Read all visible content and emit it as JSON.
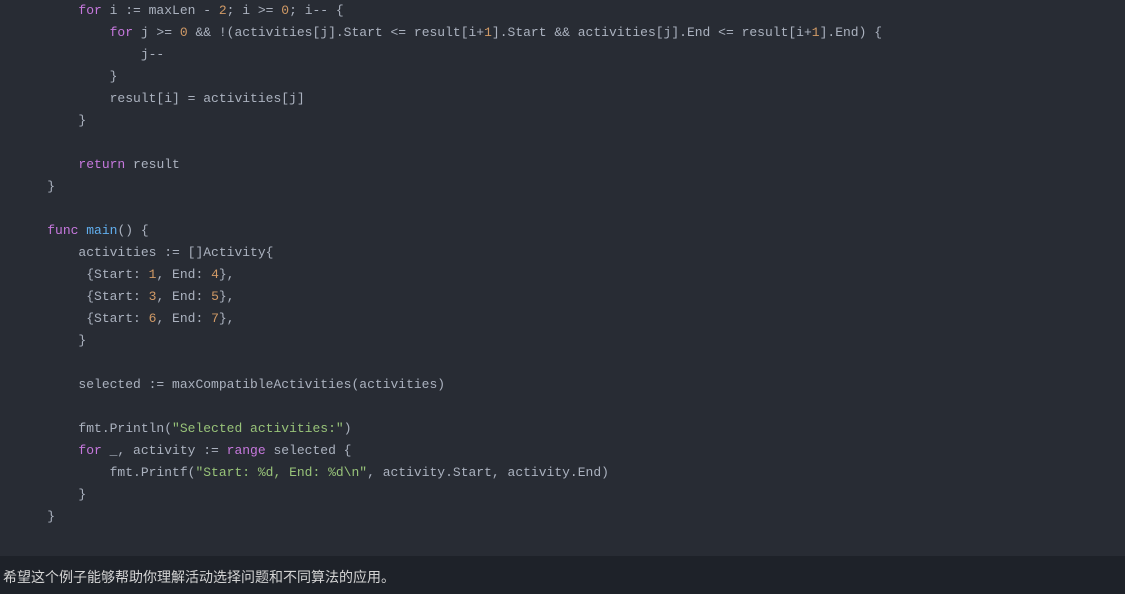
{
  "code": {
    "lines": [
      {
        "indent": 2,
        "tokens": [
          {
            "t": "keyword",
            "v": "for"
          },
          {
            "t": "plain",
            "v": " i := maxLen - "
          },
          {
            "t": "number",
            "v": "2"
          },
          {
            "t": "plain",
            "v": "; i >= "
          },
          {
            "t": "number",
            "v": "0"
          },
          {
            "t": "plain",
            "v": "; i-- {"
          }
        ]
      },
      {
        "indent": 3,
        "tokens": [
          {
            "t": "keyword",
            "v": "for"
          },
          {
            "t": "plain",
            "v": " j >= "
          },
          {
            "t": "number",
            "v": "0"
          },
          {
            "t": "plain",
            "v": " && !(activities[j].Start <= result[i+"
          },
          {
            "t": "number",
            "v": "1"
          },
          {
            "t": "plain",
            "v": "].Start && activities[j].End <= result[i+"
          },
          {
            "t": "number",
            "v": "1"
          },
          {
            "t": "plain",
            "v": "].End) {"
          }
        ]
      },
      {
        "indent": 4,
        "tokens": [
          {
            "t": "plain",
            "v": "j--"
          }
        ]
      },
      {
        "indent": 3,
        "tokens": [
          {
            "t": "plain",
            "v": "}"
          }
        ]
      },
      {
        "indent": 3,
        "tokens": [
          {
            "t": "plain",
            "v": "result[i] = activities[j]"
          }
        ]
      },
      {
        "indent": 2,
        "tokens": [
          {
            "t": "plain",
            "v": "}"
          }
        ]
      },
      {
        "indent": 0,
        "tokens": []
      },
      {
        "indent": 2,
        "tokens": [
          {
            "t": "keyword",
            "v": "return"
          },
          {
            "t": "plain",
            "v": " result"
          }
        ]
      },
      {
        "indent": 1,
        "tokens": [
          {
            "t": "plain",
            "v": "}"
          }
        ]
      },
      {
        "indent": 0,
        "tokens": []
      },
      {
        "indent": 1,
        "tokens": [
          {
            "t": "keyword",
            "v": "func"
          },
          {
            "t": "plain",
            "v": " "
          },
          {
            "t": "function",
            "v": "main"
          },
          {
            "t": "plain",
            "v": "() {"
          }
        ]
      },
      {
        "indent": 2,
        "tokens": [
          {
            "t": "plain",
            "v": "activities := []Activity{"
          }
        ]
      },
      {
        "indent": 2,
        "tokens": [
          {
            "t": "plain",
            "v": " {Start: "
          },
          {
            "t": "number",
            "v": "1"
          },
          {
            "t": "plain",
            "v": ", End: "
          },
          {
            "t": "number",
            "v": "4"
          },
          {
            "t": "plain",
            "v": "},"
          }
        ]
      },
      {
        "indent": 2,
        "tokens": [
          {
            "t": "plain",
            "v": " {Start: "
          },
          {
            "t": "number",
            "v": "3"
          },
          {
            "t": "plain",
            "v": ", End: "
          },
          {
            "t": "number",
            "v": "5"
          },
          {
            "t": "plain",
            "v": "},"
          }
        ]
      },
      {
        "indent": 2,
        "tokens": [
          {
            "t": "plain",
            "v": " {Start: "
          },
          {
            "t": "number",
            "v": "6"
          },
          {
            "t": "plain",
            "v": ", End: "
          },
          {
            "t": "number",
            "v": "7"
          },
          {
            "t": "plain",
            "v": "},"
          }
        ]
      },
      {
        "indent": 2,
        "tokens": [
          {
            "t": "plain",
            "v": "}"
          }
        ]
      },
      {
        "indent": 0,
        "tokens": []
      },
      {
        "indent": 2,
        "tokens": [
          {
            "t": "plain",
            "v": "selected := maxCompatibleActivities(activities)"
          }
        ]
      },
      {
        "indent": 0,
        "tokens": []
      },
      {
        "indent": 2,
        "tokens": [
          {
            "t": "plain",
            "v": "fmt.Println("
          },
          {
            "t": "string",
            "v": "\"Selected activities:\""
          },
          {
            "t": "plain",
            "v": ")"
          }
        ]
      },
      {
        "indent": 2,
        "tokens": [
          {
            "t": "keyword",
            "v": "for"
          },
          {
            "t": "plain",
            "v": " _, activity := "
          },
          {
            "t": "keyword",
            "v": "range"
          },
          {
            "t": "plain",
            "v": " selected {"
          }
        ]
      },
      {
        "indent": 3,
        "tokens": [
          {
            "t": "plain",
            "v": "fmt.Printf("
          },
          {
            "t": "string",
            "v": "\"Start: %d, End: %d\\n\""
          },
          {
            "t": "plain",
            "v": ", activity.Start, activity.End)"
          }
        ]
      },
      {
        "indent": 2,
        "tokens": [
          {
            "t": "plain",
            "v": "}"
          }
        ]
      },
      {
        "indent": 1,
        "tokens": [
          {
            "t": "plain",
            "v": "}"
          }
        ]
      }
    ]
  },
  "footer": {
    "text": "希望这个例子能够帮助你理解活动选择问题和不同算法的应用。"
  }
}
